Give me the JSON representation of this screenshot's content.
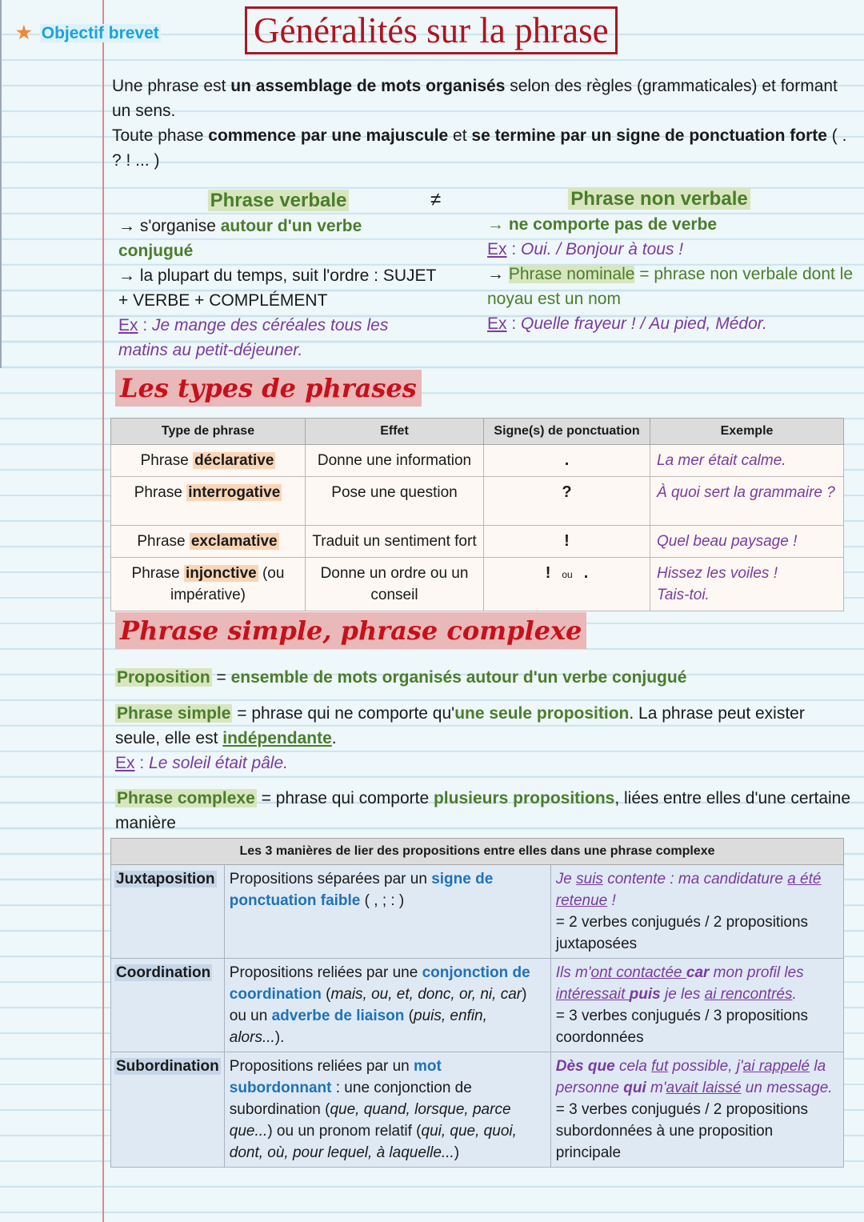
{
  "header": {
    "goal_label": "Objectif brevet",
    "title": "Généralités sur la phrase"
  },
  "intro": {
    "l1a": "Une phrase est ",
    "l1b": "un assemblage de mots organisés",
    "l1c": " selon des règles (grammaticales) et formant un sens.",
    "l2a": "Toute phase ",
    "l2b": "commence par une majuscule",
    "l2c": " et ",
    "l2d": "se termine par un signe de ponctuation forte",
    "l2e": " (  .    ?    !     ...   )"
  },
  "verbale": {
    "title": "Phrase verbale",
    "neq": "≠",
    "a1": "→ s'organise ",
    "a1g": "autour d'un verbe conjugué",
    "a2": "→ la plupart du temps, suit l'ordre : SUJET + VERBE + COMPLÉMENT",
    "ex_label": "Ex",
    "ex_sep": " : ",
    "ex": "Je mange des céréales tous les matins au petit-déjeuner."
  },
  "non_verbale": {
    "title": "Phrase non verbale",
    "a1": "→ ne comporte pas de verbe",
    "ex_label": "Ex",
    "ex_sep": " : ",
    "ex1": "Oui.    /    Bonjour à tous !",
    "arrow": "→ ",
    "nominale": "Phrase nominale",
    "nominale_def": " = phrase non verbale dont le noyau est un nom",
    "ex2": "Quelle frayeur !    /    Au pied, Médor."
  },
  "types": {
    "section": "Les types de phrases",
    "headers": [
      "Type de phrase",
      "Effet",
      "Signe(s) de ponctuation",
      "Exemple"
    ],
    "rows": [
      {
        "pre": "Phrase ",
        "kw": "déclarative",
        "post": "",
        "effet": "Donne une information",
        "sign": ".",
        "ex": "La mer était calme."
      },
      {
        "pre": "Phrase ",
        "kw": "interrogative",
        "post": "",
        "effet": "Pose une question",
        "sign": "?",
        "ex": "À quoi sert la grammaire ?"
      },
      {
        "pre": "Phrase ",
        "kw": "exclamative",
        "post": "",
        "effet": "Traduit un sentiment fort",
        "sign": "!",
        "ex": "Quel beau paysage !"
      },
      {
        "pre": "Phrase ",
        "kw": "injonctive",
        "post": " (ou impérative)",
        "effet": "Donne un ordre ou un conseil",
        "sign": "!",
        "sign_or": "ou",
        "sign2": ".",
        "ex1": "Hissez les voiles !",
        "ex2": "Tais-toi."
      }
    ]
  },
  "simple_complexe": {
    "section": "Phrase simple, phrase complexe",
    "prop_term": "Proposition",
    "prop_eq": " = ",
    "prop_def": "ensemble de mots organisés autour d'un verbe conjugué",
    "simple_term": "Phrase simple",
    "simple_a": " = phrase qui ne comporte qu'",
    "simple_g": "une seule proposition",
    "simple_b": ". La phrase peut exister seule, elle est ",
    "simple_indep": "indépendante",
    "simple_end": ".",
    "ex_label": "Ex",
    "ex_sep": " : ",
    "simple_ex": "Le soleil était pâle.",
    "complexe_term": "Phrase complexe",
    "complexe_a": " = phrase qui comporte ",
    "complexe_g": "plusieurs propositions",
    "complexe_b": ", liées entre elles d'une certaine manière"
  },
  "manieres": {
    "header": "Les 3 manières de lier des propositions entre elles dans une phrase complexe",
    "juxta": {
      "cat": "Juxtaposition",
      "d1": "Propositions séparées par un ",
      "d1b": "signe de ponctuation faible",
      "d1c": " (   ,   ;   :   )",
      "e1": "Je ",
      "e1u": "suis",
      "e2": " contente : ma candidature ",
      "e2u": "a été retenue",
      "e3": " !",
      "result": "= 2 verbes conjugués / 2 propositions juxtaposées"
    },
    "coord": {
      "cat": "Coordination",
      "d1": "Propositions reliées par une ",
      "d1b": "conjonction de coordination",
      "d1c": " (",
      "d1i": "mais, ou, et, donc, or, ni, car",
      "d1d": ") ou un ",
      "d1e": "adverbe de liaison",
      "d1f": " (",
      "d1j": "puis, enfin, alors...",
      "d1g": ").",
      "e1": "Ils m'",
      "e1u": "ont contactée ",
      "e1b": "car",
      "e2": " mon profil les ",
      "e2u": "intéressait ",
      "e2b": "puis",
      "e3": " je les ",
      "e3u": "ai rencontrés",
      "e4": ".",
      "result": "= 3 verbes conjugués / 3 propositions coordonnées"
    },
    "subord": {
      "cat": "Subordination",
      "d1": "Propositions reliées par un ",
      "d1b": "mot subordonnant",
      "d1c": " : une conjonction de subordination (",
      "d1i": "que, quand, lorsque, parce que...",
      "d1d": ") ou un pronom relatif (",
      "d1j": "qui, que, quoi, dont, où, pour lequel, à laquelle...",
      "d1e": ")",
      "e1b": "Dès que",
      "e1": " cela ",
      "e1u": "fut",
      "e2": " possible, j'",
      "e2u": "ai rappelé",
      "e3": " la personne ",
      "e3b": "qui",
      "e4": " m'",
      "e4u": "avait laissé",
      "e5": " un message.",
      "result": "= 3 verbes conjugués / 2 propositions subordonnées à une proposition principale"
    }
  }
}
